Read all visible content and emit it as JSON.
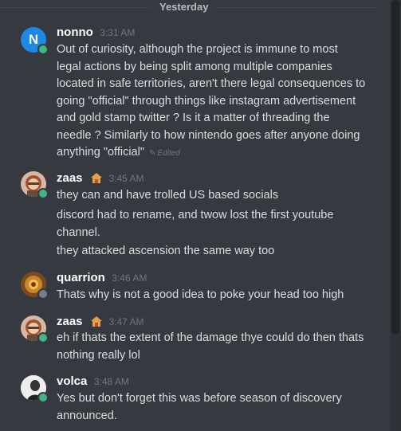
{
  "divider": {
    "label": "Yesterday"
  },
  "messages": [
    {
      "author": "nonno",
      "time": "3:31 AM",
      "lines": [
        "Out of curiosity, although the project is immune to most",
        "legal actions by being split among multiple companies",
        "located in safe territories, aren't there legal consequences to",
        "going \"official\" through things like instagram advertisement",
        "and gold stamp twitter ? Is it a matter of threading the",
        "needle ? Similarly to how nintendo goes after anyone doing",
        "anything \"official\""
      ],
      "edited_label": "Edited",
      "avatar_letter": "N",
      "avatar_color": "#1e88e5",
      "status": "online"
    },
    {
      "author": "zaas",
      "time": "3:45 AM",
      "lines": [
        "they can and have trolled US based socials",
        "discord had to rename, and twow lost the first youtube",
        "channel.",
        "they attacked ascension the same way too"
      ],
      "status": "online"
    },
    {
      "author": "quarrion",
      "time": "3:46 AM",
      "lines": [
        "Thats why is not a good idea to poke your head too high"
      ],
      "status": "offline"
    },
    {
      "author": "zaas",
      "time": "3:47 AM",
      "lines": [
        "eh if thats the extent of the damage thye could do then thats",
        "nothing really lol"
      ],
      "status": "online"
    },
    {
      "author": "volca",
      "time": "3:48 AM",
      "lines": [
        "Yes but don't forget this was before season of discovery",
        "announced."
      ],
      "status": "online"
    }
  ]
}
